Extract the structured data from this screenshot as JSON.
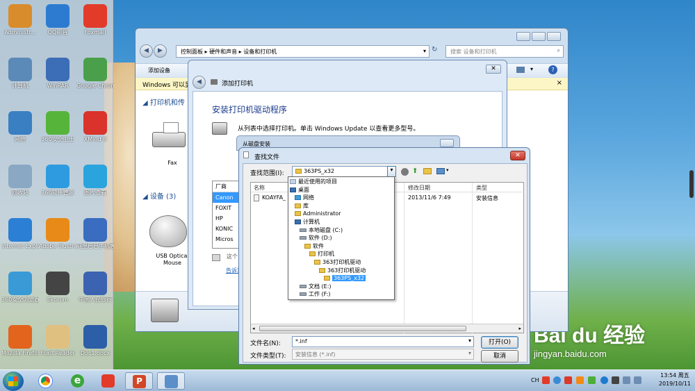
{
  "desktop": {
    "icons": [
      {
        "label": "Administr...",
        "color": "#d98c2b"
      },
      {
        "label": "QQ影音",
        "color": "#2d7bd1"
      },
      {
        "label": "Foxmail",
        "color": "#e23b2a"
      },
      {
        "label": "计算机",
        "color": "#5c8ab8"
      },
      {
        "label": "WinRAR",
        "color": "#3c6db7"
      },
      {
        "label": "Google Chrome",
        "color": "#4aa04a"
      },
      {
        "label": "网络",
        "color": "#3a7fc1"
      },
      {
        "label": "360安全卫士",
        "color": "#57b43a"
      },
      {
        "label": "XMind 8",
        "color": "#d9332b"
      },
      {
        "label": "回收站",
        "color": "#8aa8c4"
      },
      {
        "label": "360软件管家",
        "color": "#2e9be0"
      },
      {
        "label": "图片查看",
        "color": "#2aa4dd"
      },
      {
        "label": "Internet Explorer",
        "color": "#2b7fd4"
      },
      {
        "label": "Adobe Illustrato...",
        "color": "#e88a18"
      },
      {
        "label": "阿里巴巴手机客户端",
        "color": "#3a6cc0"
      },
      {
        "label": "360安全浏览器",
        "color": "#3a9ad6"
      },
      {
        "label": "Ekorum",
        "color": "#444444"
      },
      {
        "label": "中国人民银行",
        "color": "#3b63b1"
      },
      {
        "label": "Mozilla Firefox",
        "color": "#e2641d"
      },
      {
        "label": "Foxit Reader",
        "color": "#e0c080"
      },
      {
        "label": "Doc1.docx",
        "color": "#2c5fa8"
      }
    ]
  },
  "watermark": {
    "brand": "Bai du 经验",
    "url": "jingyan.baidu.com"
  },
  "explorer": {
    "path": [
      "控制面板",
      "硬件和声音",
      "设备和打印机"
    ],
    "search_placeholder": "搜索 设备和打印机",
    "cmd_add_device": "添加设备",
    "notice_text": "Windows 可以显",
    "section_printers": "打印机和传",
    "printer_label": "Fax",
    "section_devices": "设备 (3)",
    "device_label": "USB Optical Mouse"
  },
  "wizard": {
    "title": "添加打印机",
    "heading": "安装打印机驱动程序",
    "description": "从列表中选择打印机。单击 Windows Update 以查看更多型号。",
    "mfr_header": "厂商",
    "manufacturers": [
      "Canon",
      "FOXIT",
      "HP",
      "KONIC",
      "Micros"
    ],
    "note_text": "这个",
    "note_link": "告诉我"
  },
  "disk_dialog": {
    "title": "从磁盘安装"
  },
  "find_dialog": {
    "title": "查找文件",
    "lookin_label": "查找范围(I):",
    "lookin_value": "363PS_x32",
    "columns": {
      "name": "名称",
      "date": "修改日期",
      "type": "类型"
    },
    "file": {
      "name": "KOAYFA_",
      "date": "2013/11/6 7:49",
      "type": "安装信息"
    },
    "filename_label": "文件名(N):",
    "filename_value": "*.inf",
    "filetype_label": "文件类型(T):",
    "filetype_value": "安装信息 (*.inf)",
    "open_button": "打开(O)",
    "cancel_button": "取消"
  },
  "dropdown": {
    "items": [
      {
        "label": "最近使用的项目",
        "indent": 0,
        "icon": "recent-icon"
      },
      {
        "label": "桌面",
        "indent": 0,
        "icon": "desktop-icon"
      },
      {
        "label": "网络",
        "indent": 1,
        "icon": "network-icon"
      },
      {
        "label": "库",
        "indent": 1,
        "icon": "library-icon"
      },
      {
        "label": "Administrator",
        "indent": 1,
        "icon": "user-folder-icon"
      },
      {
        "label": "计算机",
        "indent": 1,
        "icon": "computer-icon"
      },
      {
        "label": "本地磁盘 (C:)",
        "indent": 2,
        "icon": "drive-icon"
      },
      {
        "label": "软件 (D:)",
        "indent": 2,
        "icon": "drive-icon"
      },
      {
        "label": "软件",
        "indent": 3,
        "icon": "folder-icon"
      },
      {
        "label": "打印机",
        "indent": 4,
        "icon": "folder-icon"
      },
      {
        "label": "363打印机驱动",
        "indent": 5,
        "icon": "folder-icon"
      },
      {
        "label": "363打印机驱动",
        "indent": 6,
        "icon": "folder-icon"
      },
      {
        "label": "363PS_x32",
        "indent": 7,
        "icon": "folder-icon",
        "selected": true
      },
      {
        "label": "文档 (E:)",
        "indent": 2,
        "icon": "drive-icon"
      },
      {
        "label": "工作 (F:)",
        "indent": 2,
        "icon": "drive-icon"
      }
    ]
  },
  "taskbar": {
    "lang": "CH",
    "time": "13:54 周五",
    "date": "2019/10/11"
  }
}
